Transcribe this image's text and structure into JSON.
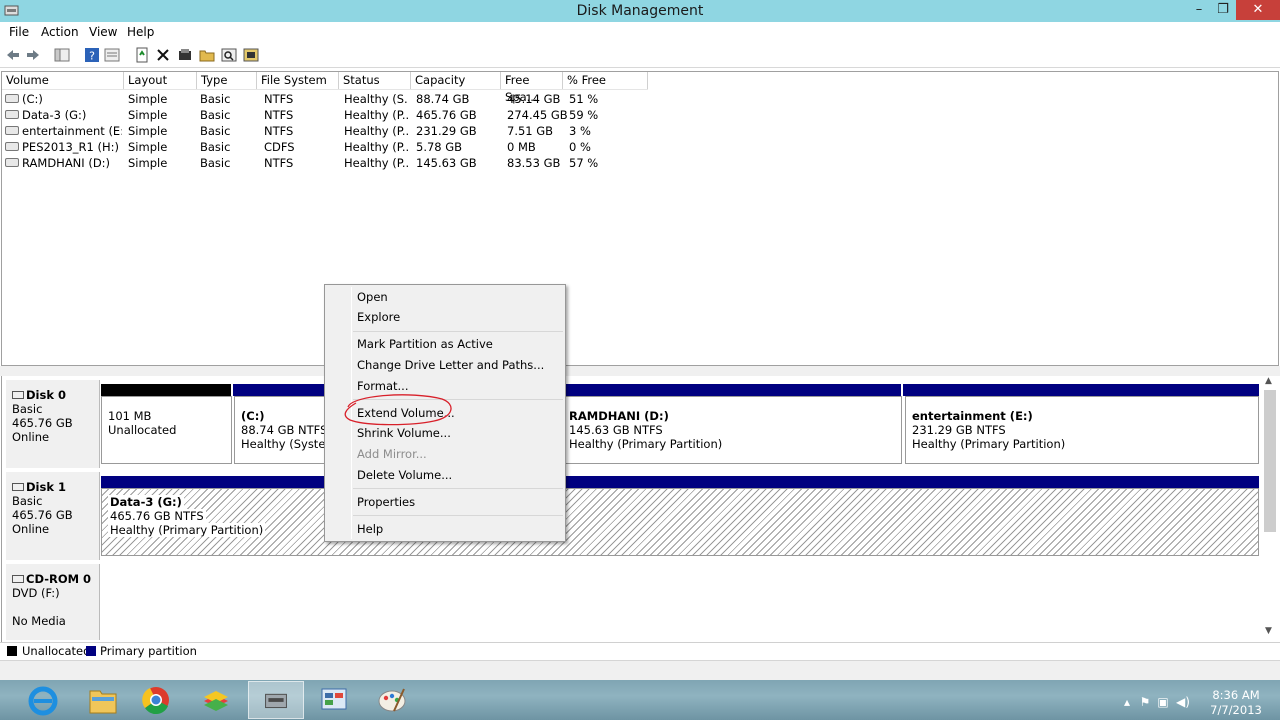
{
  "window": {
    "title": "Disk Management"
  },
  "menubar": [
    "File",
    "Action",
    "View",
    "Help"
  ],
  "volume_table": {
    "columns": [
      "Volume",
      "Layout",
      "Type",
      "File System",
      "Status",
      "Capacity",
      "Free Spa...",
      "% Free"
    ],
    "rows": [
      [
        "(C:)",
        "Simple",
        "Basic",
        "NTFS",
        "Healthy (S...",
        "88.74 GB",
        "45.14 GB",
        "51 %"
      ],
      [
        "Data-3 (G:)",
        "Simple",
        "Basic",
        "NTFS",
        "Healthy (P...",
        "465.76 GB",
        "274.45 GB",
        "59 %"
      ],
      [
        "entertainment (E:)",
        "Simple",
        "Basic",
        "NTFS",
        "Healthy (P...",
        "231.29 GB",
        "7.51 GB",
        "3 %"
      ],
      [
        "PES2013_R1 (H:)",
        "Simple",
        "Basic",
        "CDFS",
        "Healthy (P...",
        "5.78 GB",
        "0 MB",
        "0 %"
      ],
      [
        "RAMDHANI (D:)",
        "Simple",
        "Basic",
        "NTFS",
        "Healthy (P...",
        "145.63 GB",
        "83.53 GB",
        "57 %"
      ]
    ]
  },
  "disks": [
    {
      "name": "Disk 0",
      "type": "Basic",
      "size": "465.76 GB",
      "state": "Online",
      "partitions": [
        {
          "name": "",
          "size": "101 MB",
          "status": "Unallocated"
        },
        {
          "name": "(C:)",
          "size": "88.74 GB NTFS",
          "status": "Healthy (System,"
        },
        {
          "name": "RAMDHANI  (D:)",
          "size": "145.63 GB NTFS",
          "status": "Healthy (Primary Partition)"
        },
        {
          "name": "entertainment  (E:)",
          "size": "231.29 GB NTFS",
          "status": "Healthy (Primary Partition)"
        }
      ]
    },
    {
      "name": "Disk 1",
      "type": "Basic",
      "size": "465.76 GB",
      "state": "Online",
      "partitions": [
        {
          "name": "Data-3  (G:)",
          "size": "465.76 GB NTFS",
          "status": "Healthy (Primary Partition)"
        }
      ]
    },
    {
      "name": "CD-ROM 0",
      "type": "DVD (F:)",
      "size": "",
      "state": "No Media",
      "partitions": []
    }
  ],
  "legend": [
    {
      "label": "Unallocated",
      "color": "#000000"
    },
    {
      "label": "Primary partition",
      "color": "#000080"
    }
  ],
  "context_menu": {
    "items": [
      {
        "label": "Open",
        "enabled": true
      },
      {
        "label": "Explore",
        "enabled": true
      },
      {
        "label": "Mark Partition as Active",
        "enabled": true
      },
      {
        "label": "Change Drive Letter and Paths...",
        "enabled": true
      },
      {
        "label": "Format...",
        "enabled": true
      },
      {
        "label": "Extend Volume...",
        "enabled": true
      },
      {
        "label": "Shrink Volume...",
        "enabled": true
      },
      {
        "label": "Add Mirror...",
        "enabled": false
      },
      {
        "label": "Delete Volume...",
        "enabled": true
      },
      {
        "label": "Properties",
        "enabled": true
      },
      {
        "label": "Help",
        "enabled": true
      }
    ]
  },
  "taskbar": {
    "apps": [
      "internet-explorer-icon",
      "file-explorer-icon",
      "chrome-icon",
      "bluestacks-icon",
      "disk-management-icon",
      "control-panel-icon",
      "paint-icon"
    ],
    "clock": {
      "time": "8:36 AM",
      "date": "7/7/2013"
    }
  },
  "colors": {
    "titlebar": "#8fd6e2",
    "primary": "#000080",
    "unallocated": "#000000",
    "annotation": "#d8202a",
    "close": "#c7403a"
  }
}
